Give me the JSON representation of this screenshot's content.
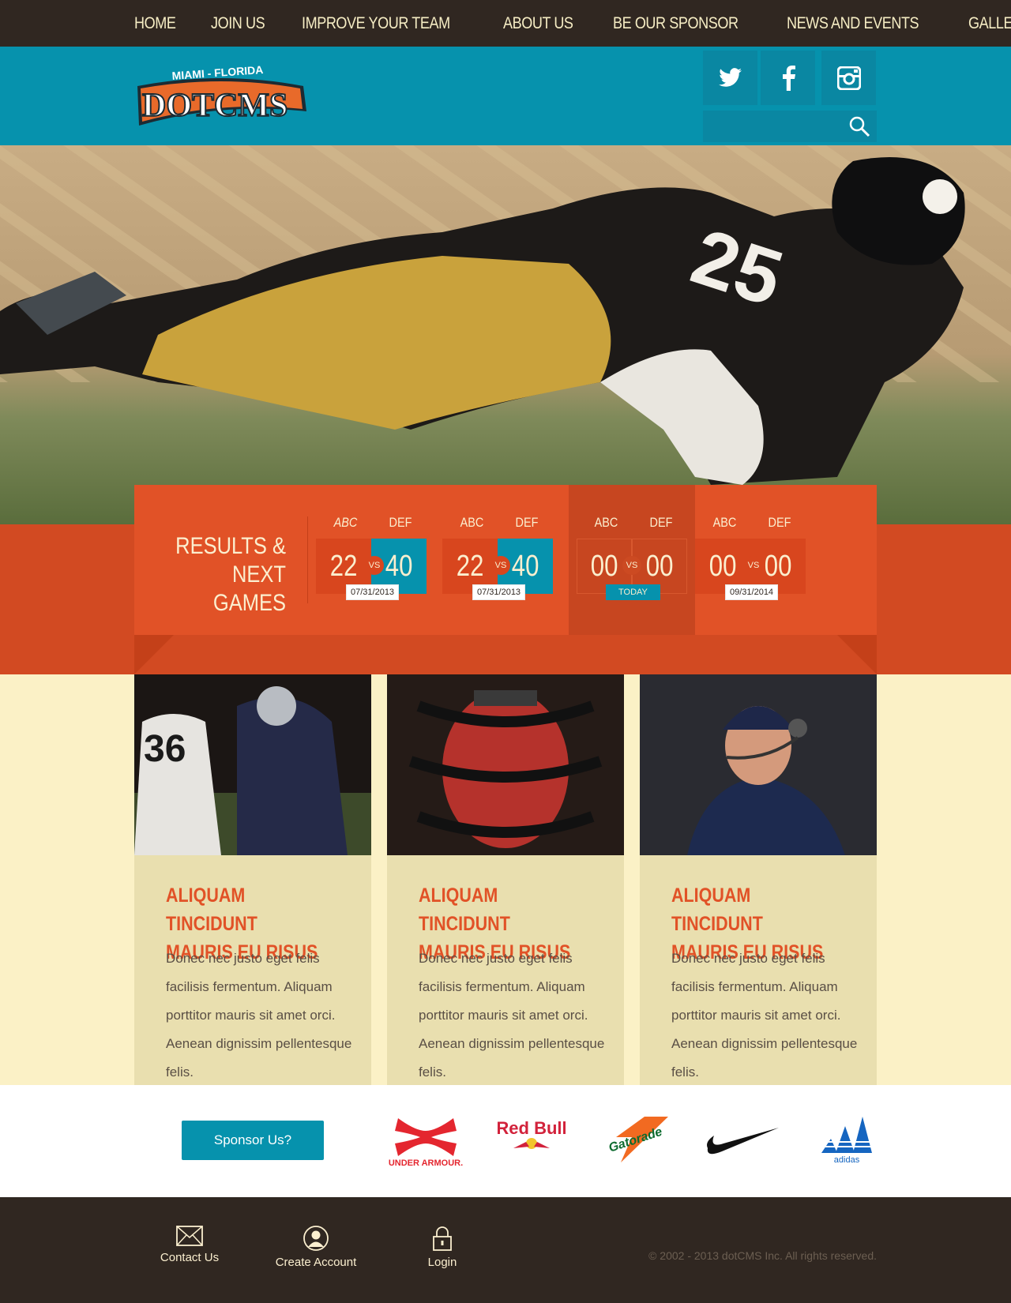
{
  "nav": {
    "items": [
      "HOME",
      "JOIN US",
      "IMPROVE YOUR TEAM",
      "ABOUT US",
      "BE OUR SPONSOR",
      "NEWS AND EVENTS",
      "GALLERY"
    ]
  },
  "header": {
    "logo_top": "MIAMI - FLORIDA",
    "logo_main": "DOTCMS",
    "social": [
      "twitter-icon",
      "facebook-icon",
      "instagram-icon"
    ],
    "search_placeholder": ""
  },
  "results": {
    "title_line1": "RESULTS &",
    "title_line2": "NEXT GAMES",
    "games": [
      {
        "home": "ABC",
        "away": "DEF",
        "home_score": "22",
        "away_score": "40",
        "vs": "VS",
        "date": "07/31/2013"
      },
      {
        "home": "ABC",
        "away": "DEF",
        "home_score": "22",
        "away_score": "40",
        "vs": "VS",
        "date": "07/31/2013"
      },
      {
        "home": "ABC",
        "away": "DEF",
        "home_score": "00",
        "away_score": "00",
        "vs": "VS",
        "date": "TODAY"
      },
      {
        "home": "ABC",
        "away": "DEF",
        "home_score": "00",
        "away_score": "00",
        "vs": "VS",
        "date": "09/31/2014"
      }
    ]
  },
  "cards": [
    {
      "title": "ALIQUAM TINCIDUNT MAURIS EU RISUS",
      "text": "Donec nec justo eget felis facilisis fermentum. Aliquam porttitor mauris sit amet orci. Aenean dignissim pellentesque felis."
    },
    {
      "title": "ALIQUAM TINCIDUNT MAURIS EU RISUS",
      "text": "Donec nec justo eget felis facilisis fermentum. Aliquam porttitor mauris sit amet orci. Aenean dignissim pellentesque felis."
    },
    {
      "title": "ALIQUAM TINCIDUNT MAURIS EU RISUS",
      "text": "Donec nec justo eget felis facilisis fermentum. Aliquam porttitor mauris sit amet orci. Aenean dignissim pellentesque felis."
    }
  ],
  "sponsors": {
    "button_label": "Sponsor Us?",
    "ua_text": "UNDER ARMOUR.",
    "redbull_text": "Red Bull",
    "gatorade_text": "Gatorade",
    "adidas_text": "adidas"
  },
  "footer": {
    "contact": "Contact Us",
    "create_account": "Create Account",
    "login": "Login",
    "copyright": "© 2002 - 2013 dotCMS Inc. All rights reserved."
  },
  "colors": {
    "nav_bg": "#302721",
    "header_bg": "#0692ad",
    "accent_orange": "#e15227",
    "cream": "#fbf1c6",
    "card_bg": "#e9dfaf"
  }
}
